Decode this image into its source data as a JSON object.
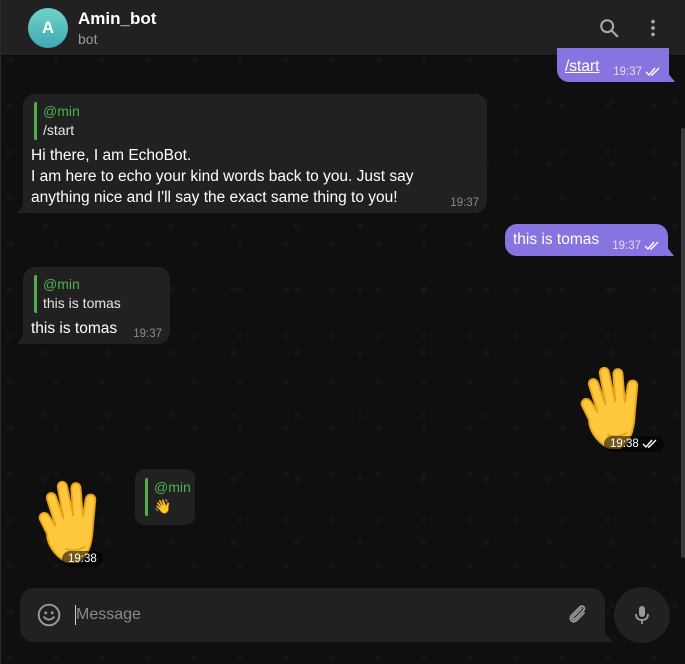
{
  "header": {
    "avatar_letter": "A",
    "title": "Amin_bot",
    "subtitle": "bot"
  },
  "messages": [
    {
      "direction": "out",
      "text": "/start",
      "time": "19:37",
      "status": "read"
    },
    {
      "direction": "in",
      "reply": {
        "name": "@min",
        "text": "/start"
      },
      "lines": [
        "Hi there, I am EchoBot.",
        "I am here to echo your kind words back to you. Just say",
        "anything nice and I'll say the exact same thing to you!"
      ],
      "time": "19:37"
    },
    {
      "direction": "out",
      "text": "this is tomas",
      "time": "19:37",
      "status": "read"
    },
    {
      "direction": "in",
      "reply": {
        "name": "@min",
        "text": "this is tomas"
      },
      "text": "this is tomas",
      "time": "19:37"
    },
    {
      "direction": "out",
      "sticker": "waving-hand",
      "time": "19:38",
      "status": "read"
    },
    {
      "direction": "in",
      "sticker": "waving-hand",
      "reply": {
        "name": "@min",
        "text": "👋"
      },
      "time": "19:38"
    }
  ],
  "composer": {
    "placeholder": "Message",
    "value": ""
  },
  "colors": {
    "accent": "#8774e1",
    "reply_bar": "#4fae4e",
    "bubble_in": "#212121",
    "avatar": "#3ea9b3"
  }
}
